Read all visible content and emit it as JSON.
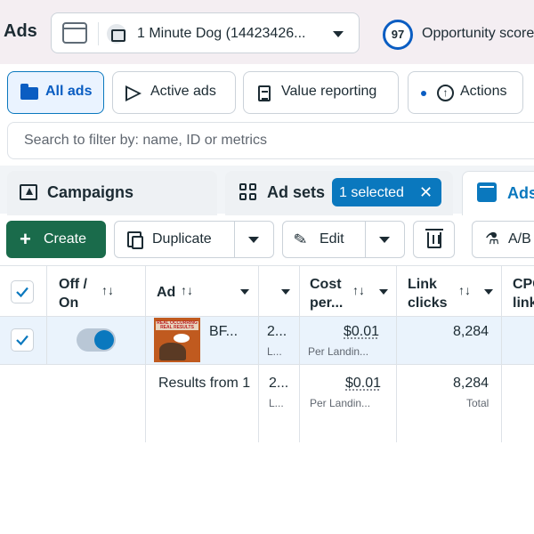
{
  "header": {
    "title": "Ads",
    "account_name": "1 Minute Dog (14423426...",
    "opportunity_score": "97",
    "opportunity_label": "Opportunity score"
  },
  "views": {
    "all_ads": "All ads",
    "active_ads": "Active ads",
    "value_reporting": "Value reporting",
    "actions": "Actions"
  },
  "search": {
    "placeholder": "Search to filter by: name, ID or metrics"
  },
  "levels": {
    "campaigns": "Campaigns",
    "ad_sets": "Ad sets",
    "selected_chip": "1 selected",
    "chip_close": "✕",
    "ads": "Ads"
  },
  "toolbar": {
    "create": "Create",
    "duplicate": "Duplicate",
    "edit": "Edit",
    "ab_test": "A/B"
  },
  "table": {
    "columns": {
      "off_on_1": "Off /",
      "off_on_2": "On",
      "ad": "Ad",
      "cost_1": "Cost",
      "cost_2": "per...",
      "link_clicks_1": "Link",
      "link_clicks_2": "clicks",
      "cpc_1": "CPC",
      "cpc_2": "link"
    },
    "sort_glyph": "↑↓",
    "row": {
      "ad_name": "BF...",
      "thumb_text": "REAL OCCURRING REAL RESULTS",
      "results_value": "2...",
      "results_sub": "L...",
      "cost_value": "$0.01",
      "cost_sub": "Per Landin...",
      "link_clicks": "8,284"
    },
    "summary": {
      "label": "Results from 1",
      "results_value": "2...",
      "results_sub": "L...",
      "cost_value": "$0.01",
      "cost_sub": "Per Landin...",
      "link_clicks": "8,284",
      "link_clicks_sub": "Total"
    }
  },
  "colors": {
    "accent": "#0a78be",
    "create_button": "#1a6b4b",
    "selected_row": "#eaf3fc",
    "topbar": "#f4eef2"
  }
}
